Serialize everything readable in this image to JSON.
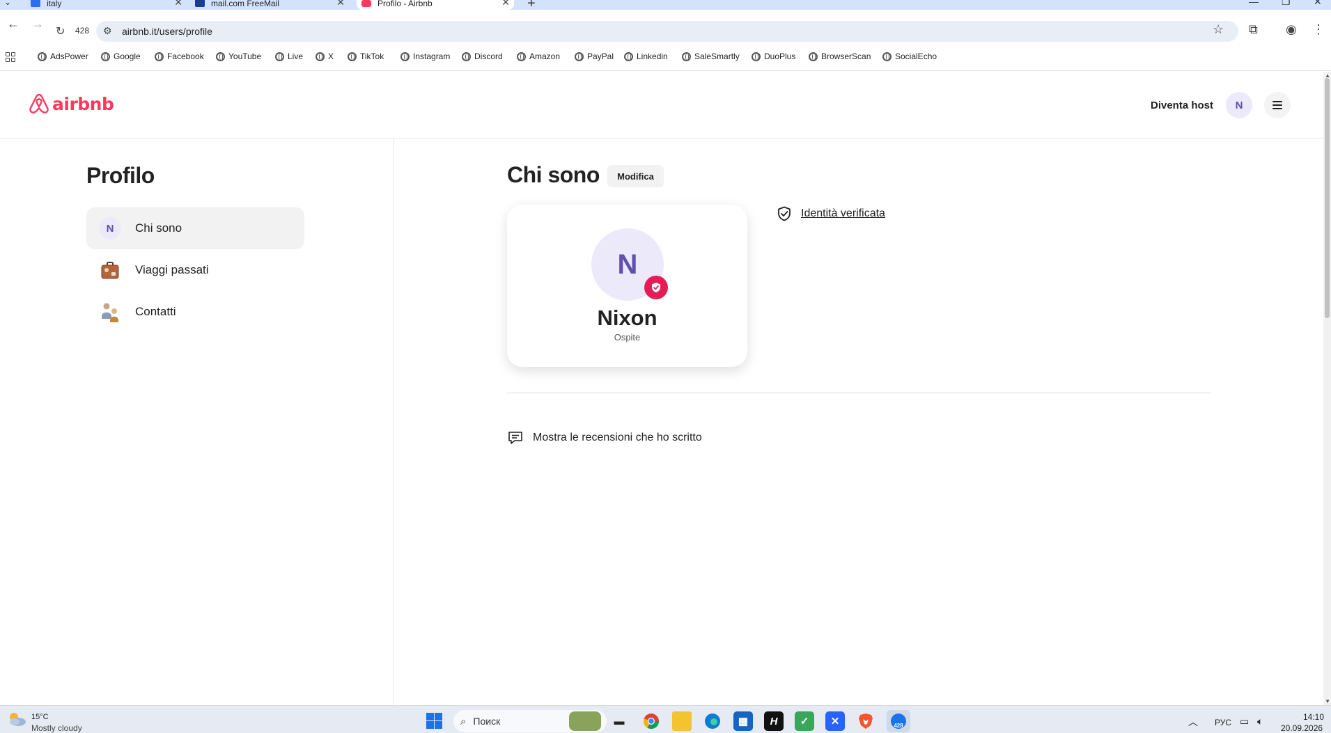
{
  "browser": {
    "tabs": [
      {
        "title": "italy",
        "active": false
      },
      {
        "title": "mail.com FreeMail",
        "active": false
      },
      {
        "title": "Profilo - Airbnb",
        "active": true
      }
    ],
    "reload_badge": "428",
    "url": "airbnb.it/users/profile",
    "bookmarks": [
      "AdsPower",
      "Google",
      "Facebook",
      "YouTube",
      "Live",
      "X",
      "TikTok",
      "Instagram",
      "Discord",
      "Amazon",
      "PayPal",
      "Linkedin",
      "SaleSmartly",
      "DuoPlus",
      "BrowserScan",
      "SocialEcho"
    ]
  },
  "header": {
    "logo_text": "airbnb",
    "host_link": "Diventa host",
    "avatar_initial": "N"
  },
  "sidebar": {
    "title": "Profilo",
    "items": [
      {
        "label": "Chi sono",
        "icon": "N",
        "active": true
      },
      {
        "label": "Viaggi passati",
        "icon": "suitcase-icon",
        "active": false
      },
      {
        "label": "Contatti",
        "icon": "people-icon",
        "active": false
      }
    ]
  },
  "main": {
    "title": "Chi sono",
    "edit_label": "Modifica",
    "card": {
      "initial": "N",
      "name": "Nixon",
      "role": "Ospite"
    },
    "verified_label": "Identità verificata",
    "reviews_label": "Mostra le recensioni che ho scritto"
  },
  "taskbar": {
    "temperature": "15°C",
    "weather": "Mostly cloudy",
    "search_placeholder": "Поиск",
    "app_badge": "428",
    "language": "РУС",
    "time": "14:10",
    "date": "20.09.2026"
  },
  "colors": {
    "airbnb_red": "#ff385c",
    "avatar_bg": "#ece9fb",
    "avatar_text": "#6150a9",
    "badge_red": "#e41d57"
  }
}
